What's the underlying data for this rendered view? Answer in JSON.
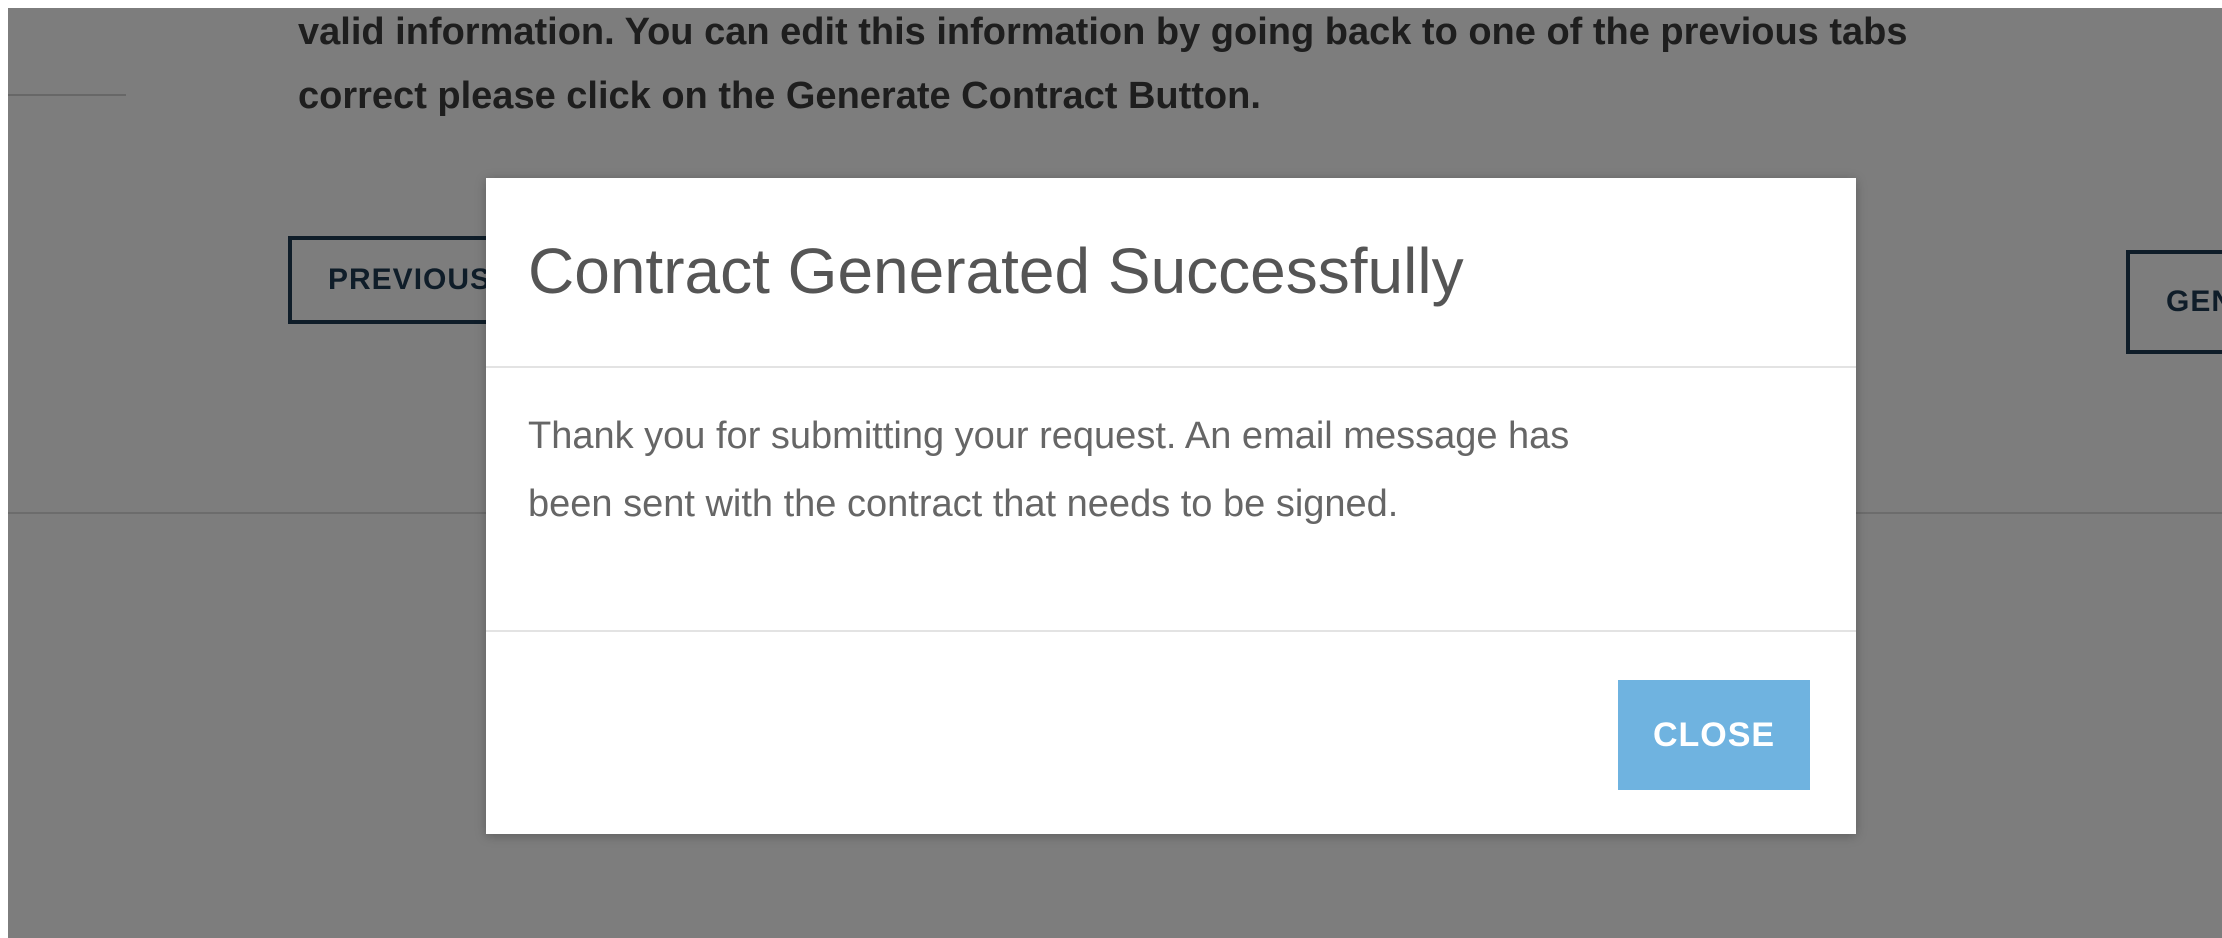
{
  "page": {
    "instruction_line1": "valid information. You can edit this information by going back to one of the previous tabs",
    "instruction_line2": "correct please click on the Generate Contract Button.",
    "previous_label": "PREVIOUS",
    "generate_label": "GENERATE CONTRACT"
  },
  "modal": {
    "title": "Contract Generated Successfully",
    "body_line1": "Thank you for submitting your request. An email message has",
    "body_line2": "been sent with the contract that needs to be signed.",
    "close_label": "CLOSE"
  },
  "colors": {
    "overlay": "#7a7a7a",
    "outline_button": "#1f3a52",
    "close_button": "#6fb3e0"
  }
}
